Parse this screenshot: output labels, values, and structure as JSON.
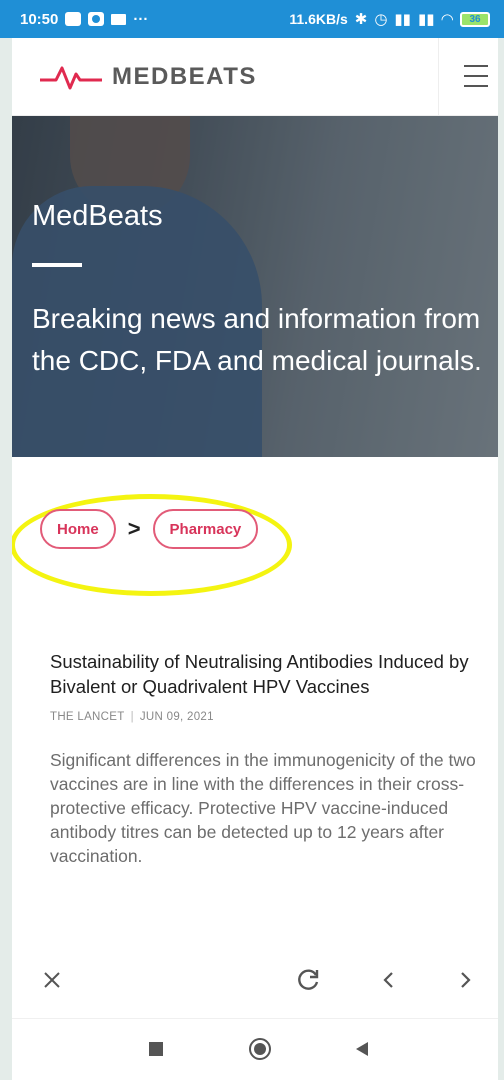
{
  "status_bar": {
    "time": "10:50",
    "dots": "···",
    "net_speed": "11.6KB/s",
    "battery": "36"
  },
  "header": {
    "logo_text": "MEDBEATS",
    "brand_color": "#e02a4f"
  },
  "hero": {
    "title": "MedBeats",
    "subtitle": "Breaking news and information from the CDC, FDA and medical journals."
  },
  "breadcrumb": {
    "items": [
      "Home",
      "Pharmacy"
    ],
    "separator": ">"
  },
  "article": {
    "title": "Sustainability of Neutralising Antibodies Induced by Bivalent or Quadrivalent HPV Vaccines",
    "source": "THE LANCET",
    "date": "JUN 09, 2021",
    "summary": "Significant differences in the immunogenicity of the two vaccines are in line with the differences in their cross-protective efficacy. Protective HPV vaccine-induced antibody titres can be detected up to 12 years after vaccination."
  },
  "icons": {
    "toolbar": [
      "close-icon",
      "reload-icon",
      "back-icon",
      "forward-icon"
    ],
    "navigation": [
      "recent-apps-icon",
      "home-icon",
      "back-triangle-icon"
    ]
  },
  "colors": {
    "accent": "#d8345a",
    "status_bar": "#1f8fd6",
    "highlight": "#f4f411"
  }
}
